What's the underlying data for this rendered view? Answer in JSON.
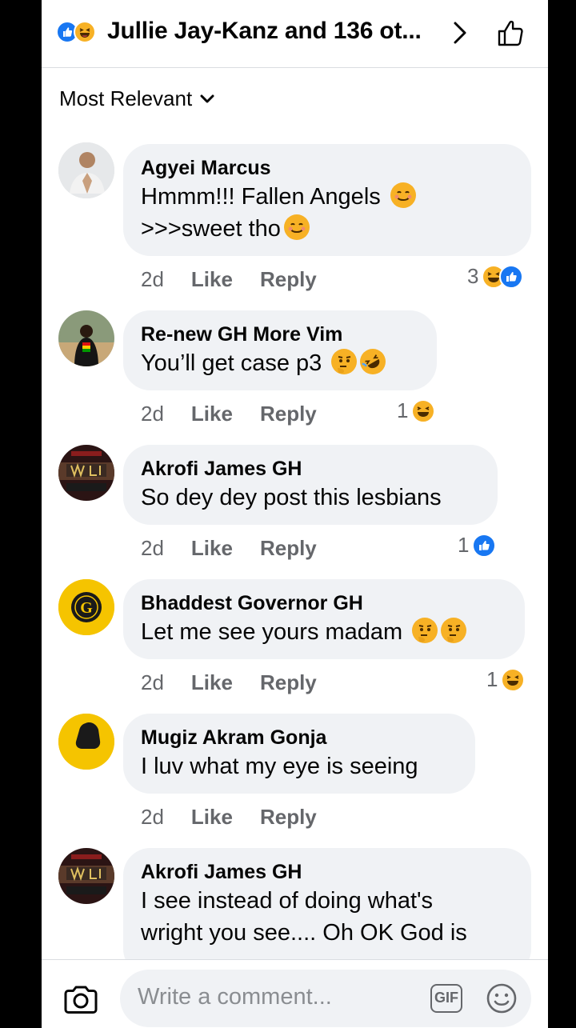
{
  "header": {
    "title": "Jullie Jay-Kanz and 136 ot...",
    "reaction_icons": [
      "like-icon",
      "haha-icon"
    ]
  },
  "sort": {
    "label": "Most Relevant"
  },
  "comments": [
    {
      "author": "Agyei Marcus",
      "lines": [
        "Hmmm!!! Fallen Angels",
        ">>>sweet tho"
      ],
      "line_emojis": [
        "smiling-blush-emoji",
        "smiling-blush-emoji"
      ],
      "time": "2d",
      "like": "Like",
      "reply": "Reply",
      "reaction_count": "3",
      "reactions": [
        "haha",
        "like"
      ]
    },
    {
      "author": "Re-new GH More Vim",
      "lines": [
        "You’ll get case p3"
      ],
      "line_emojis": [
        "thinking-emoji rofl-emoji"
      ],
      "time": "2d",
      "like": "Like",
      "reply": "Reply",
      "reaction_count": "1",
      "reactions": [
        "haha"
      ]
    },
    {
      "author": "Akrofi James GH",
      "lines": [
        "So dey dey post this lesbians"
      ],
      "time": "2d",
      "like": "Like",
      "reply": "Reply",
      "reaction_count": "1",
      "reactions": [
        "like"
      ]
    },
    {
      "author": "Bhaddest Governor GH",
      "lines": [
        "Let me see yours madam"
      ],
      "line_emojis": [
        "thinking-emoji thinking-emoji"
      ],
      "time": "2d",
      "like": "Like",
      "reply": "Reply",
      "reaction_count": "1",
      "reactions": [
        "haha"
      ]
    },
    {
      "author": "Mugiz Akram Gonja",
      "lines": [
        "I luv what my eye is seeing"
      ],
      "time": "2d",
      "like": "Like",
      "reply": "Reply"
    },
    {
      "author": "Akrofi James GH",
      "lines": [
        "I see instead of doing what's",
        "wright you see.... Oh OK God is"
      ]
    }
  ],
  "composer": {
    "placeholder": "Write a comment...",
    "gif_label": "GIF"
  },
  "colors": {
    "like_blue": "#1877f2",
    "haha_yellow": "#f7b125",
    "bubble_bg": "#f0f2f5",
    "secondary_text": "#65676b"
  }
}
